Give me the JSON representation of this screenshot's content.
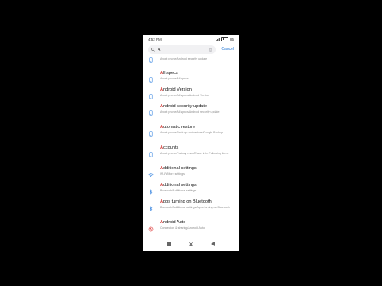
{
  "status": {
    "time": "4:52 PM",
    "battery": "85"
  },
  "search": {
    "query": "A",
    "cancel_label": "Cancel"
  },
  "colors": {
    "accent": "#2a7bd6",
    "highlight": "#d1322d"
  },
  "results": [
    {
      "title_hl": "A",
      "title_rest": "ndroid security update",
      "desc": "About phone/Android security update",
      "icon": "phone-icon"
    },
    {
      "title_hl": "A",
      "title_rest": "ll specs",
      "desc": "About phone/All specs",
      "icon": "phone-icon"
    },
    {
      "title_hl": "A",
      "title_rest": "ndroid Version",
      "desc": "About phone/All specs/Android Version",
      "icon": "phone-icon"
    },
    {
      "title_hl": "A",
      "title_rest": "ndroid security update",
      "desc": "About phone/All specs/Android security update",
      "icon": "phone-icon"
    },
    {
      "title_hl": "A",
      "title_rest": "utomatic restore",
      "desc": "About phone/Back up and restore/Google Backup",
      "icon": "phone-icon"
    },
    {
      "title_hl": "A",
      "title_rest": "ccounts",
      "desc": "About phone/Factory reset/Erase info: Following items",
      "icon": "phone-icon"
    },
    {
      "title_hl": "A",
      "title_rest": "dditional settings",
      "desc": "Wi-Fi/More settings",
      "icon": "wifi-icon"
    },
    {
      "title_hl": "A",
      "title_rest": "dditional settings",
      "desc": "Bluetooth/Additional settings",
      "icon": "bluetooth-icon"
    },
    {
      "title_hl": "A",
      "title_rest": "pps turning on Bluetooth",
      "desc": "Bluetooth/Additional settings/Apps turning on Bluetooth",
      "icon": "bluetooth-icon"
    },
    {
      "title_hl": "A",
      "title_rest": "ndroid Auto",
      "desc": "Connection & sharing/Android Auto",
      "icon": "android-auto-icon"
    }
  ]
}
